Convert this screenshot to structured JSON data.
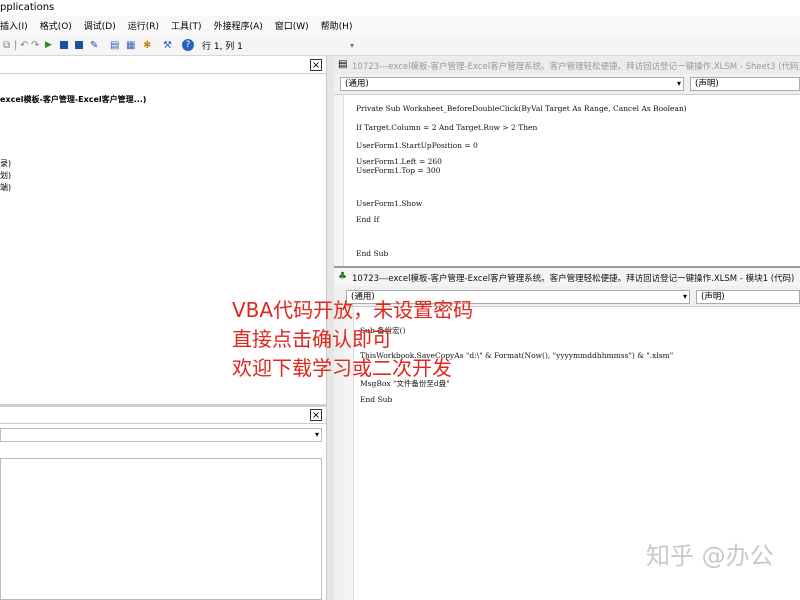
{
  "window": {
    "title_fragment": "pplications"
  },
  "menu": [
    "插入(I)",
    "格式(O)",
    "调试(D)",
    "运行(R)",
    "工具(T)",
    "外接程序(A)",
    "窗口(W)",
    "帮助(H)"
  ],
  "menu_display": [
    "插入(I)",
    "格式(O)",
    "调试(D)",
    "运行(R)",
    "工具(T)",
    "外接程序(A)",
    "窗口(W)",
    "帮助(H)"
  ],
  "toolbar": {
    "position": "行 1, 列 1"
  },
  "project_tree": {
    "items": [
      "excel模板-客户管理-Excel客户管理...)",
      "录)",
      "划)",
      "端)"
    ]
  },
  "code_window_1": {
    "title": "10723---excel模板-客户管理-Excel客户管理系统。客户管理轻松便捷。拜访回访登记一键操作.XLSM - Sheet3 (代码)",
    "object_combo": "(通用)",
    "proc_combo": "(声明)",
    "lines": [
      "Private Sub Worksheet_BeforeDoubleClick(ByVal Target As Range, Cancel As Boolean)",
      "If Target.Column = 2 And Target.Row > 2 Then",
      "UserForm1.StartUpPosition = 0",
      "UserForm1.Left = 260",
      "UserForm1.Top = 300",
      "UserForm1.Show",
      "End If",
      "End Sub"
    ]
  },
  "code_window_2": {
    "title": "10723---excel模板-客户管理-Excel客户管理系统。客户管理轻松便捷。拜访回访登记一键操作.XLSM - 模块1 (代码)",
    "object_combo": "(通用)",
    "proc_combo": "(声明)",
    "lines": [
      "Sub 备份宏()",
      "ThisWorkbook.SaveCopyAs \"d:\\\" & Format(Now(), \"yyyymmddhhmmss\") & \".xlsm\"",
      "MsgBox \"文件备份至d盘\"",
      "End Sub"
    ]
  },
  "overlay": {
    "lines": [
      "VBA代码开放，未设置密码",
      "直接点击确认即可",
      "欢迎下载学习或二次开发"
    ],
    "color": "#e0271e"
  },
  "watermark": "知乎 @办公"
}
